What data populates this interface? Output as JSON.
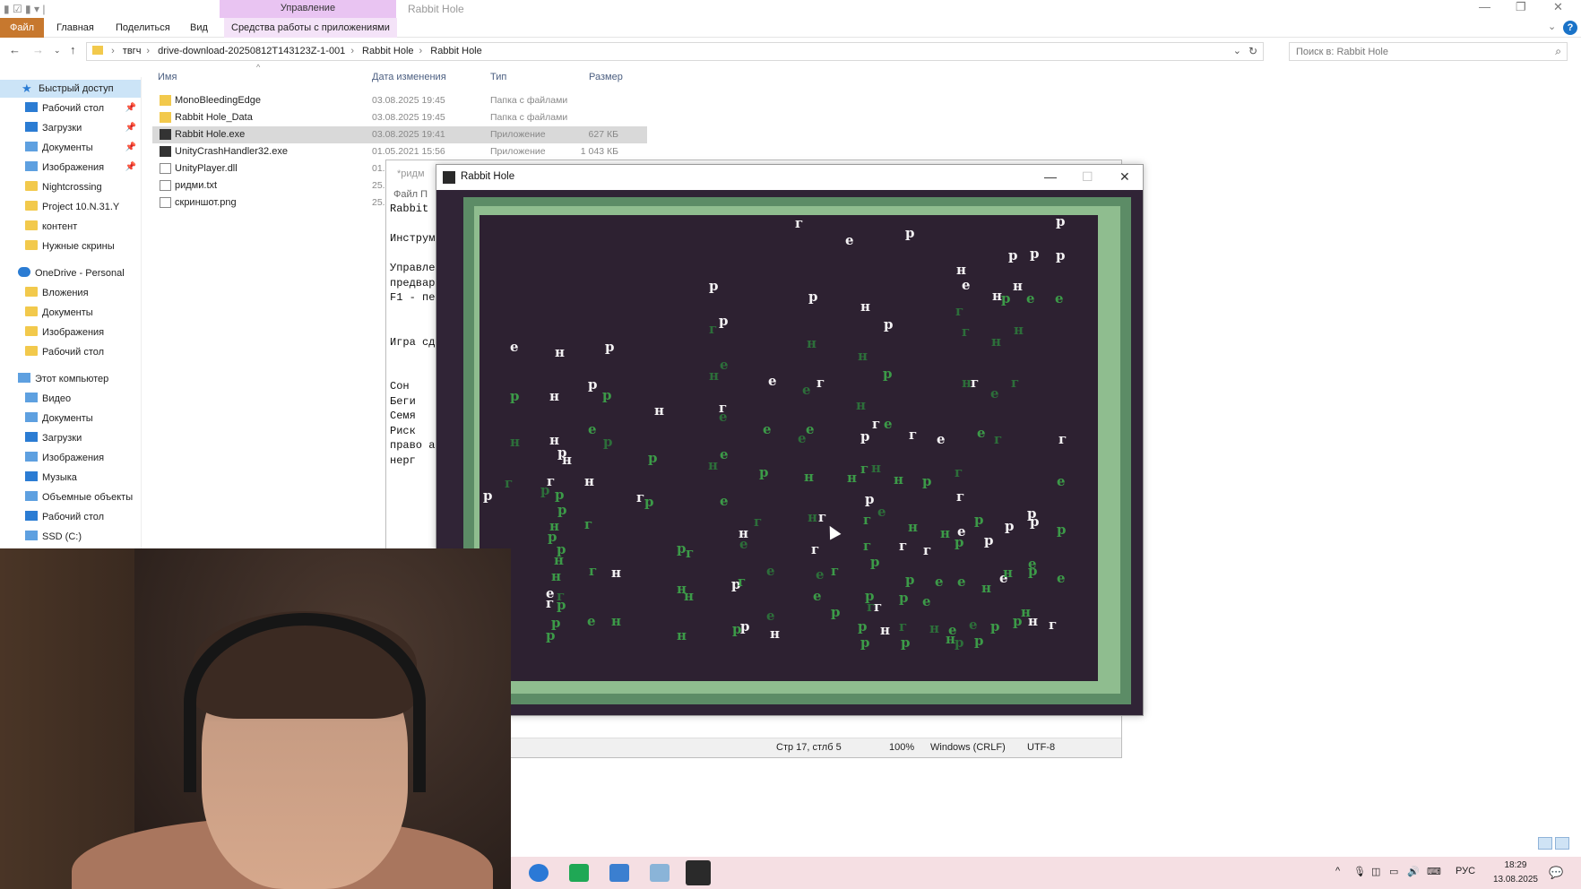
{
  "explorer": {
    "window_title": "Rabbit Hole",
    "context_tab_group": "Управление",
    "ribbon_tabs": {
      "file": "Файл",
      "home": "Главная",
      "share": "Поделиться",
      "view": "Вид",
      "app_tools": "Средства работы с приложениями"
    },
    "breadcrumb": [
      "твгч",
      "drive-download-20250812T143123Z-1-001",
      "Rabbit Hole",
      "Rabbit Hole"
    ],
    "search_placeholder": "Поиск в: Rabbit Hole",
    "columns": {
      "name": "Имя",
      "date": "Дата изменения",
      "type": "Тип",
      "size": "Размер"
    },
    "files": [
      {
        "name": "MonoBleedingEdge",
        "date": "03.08.2025 19:45",
        "type": "Папка с файлами",
        "size": "",
        "icon": "folder-icon"
      },
      {
        "name": "Rabbit Hole_Data",
        "date": "03.08.2025 19:45",
        "type": "Папка с файлами",
        "size": "",
        "icon": "folder-icon"
      },
      {
        "name": "Rabbit Hole.exe",
        "date": "03.08.2025 19:41",
        "type": "Приложение",
        "size": "627 КБ",
        "icon": "app-icon"
      },
      {
        "name": "UnityCrashHandler32.exe",
        "date": "01.05.2021 15:56",
        "type": "Приложение",
        "size": "1 043 КБ",
        "icon": "app-icon"
      },
      {
        "name": "UnityPlayer.dll",
        "date": "01.",
        "type": "",
        "size": "",
        "icon": "dll-icon"
      },
      {
        "name": "ридми.txt",
        "date": "25.",
        "type": "",
        "size": "",
        "icon": "text-file-icon"
      },
      {
        "name": "скриншот.png",
        "date": "25.",
        "type": "",
        "size": "",
        "icon": "image-file-icon"
      }
    ],
    "sidebar": {
      "quick_access": "Быстрый доступ",
      "quick_items": [
        "Рабочий стол",
        "Загрузки",
        "Документы",
        "Изображения",
        "Nightcrossing",
        "Project 10.N.31.Y",
        "контент",
        "Нужные скрины"
      ],
      "onedrive": "OneDrive - Personal",
      "onedrive_items": [
        "Вложения",
        "Документы",
        "Изображения",
        "Рабочий стол"
      ],
      "this_pc": "Этот компьютер",
      "pc_items": [
        "Видео",
        "Документы",
        "Загрузки",
        "Изображения",
        "Музыка",
        "Объемные объекты",
        "Рабочий стол",
        "SSD (C:)"
      ]
    }
  },
  "notepad": {
    "title": "*ридм",
    "menu": "Файл  П",
    "lines": [
      "Rabbit",
      "",
      "Инструм",
      "",
      "Управле",
      "предвар",
      "F1 - пе",
      "",
      "",
      "Игра сд",
      "",
      "",
      "Сон",
      "Беги",
      "Семя",
      "Риск",
      "право а",
      "нерг"
    ],
    "status": {
      "position": "Стр 17, стлб 5",
      "zoom": "100%",
      "eol": "Windows (CRLF)",
      "encoding": "UTF-8"
    }
  },
  "game": {
    "title": "Rabbit Hole"
  },
  "taskbar": {
    "language": "РУС",
    "time": "18:29",
    "date": "13.08.2025"
  }
}
